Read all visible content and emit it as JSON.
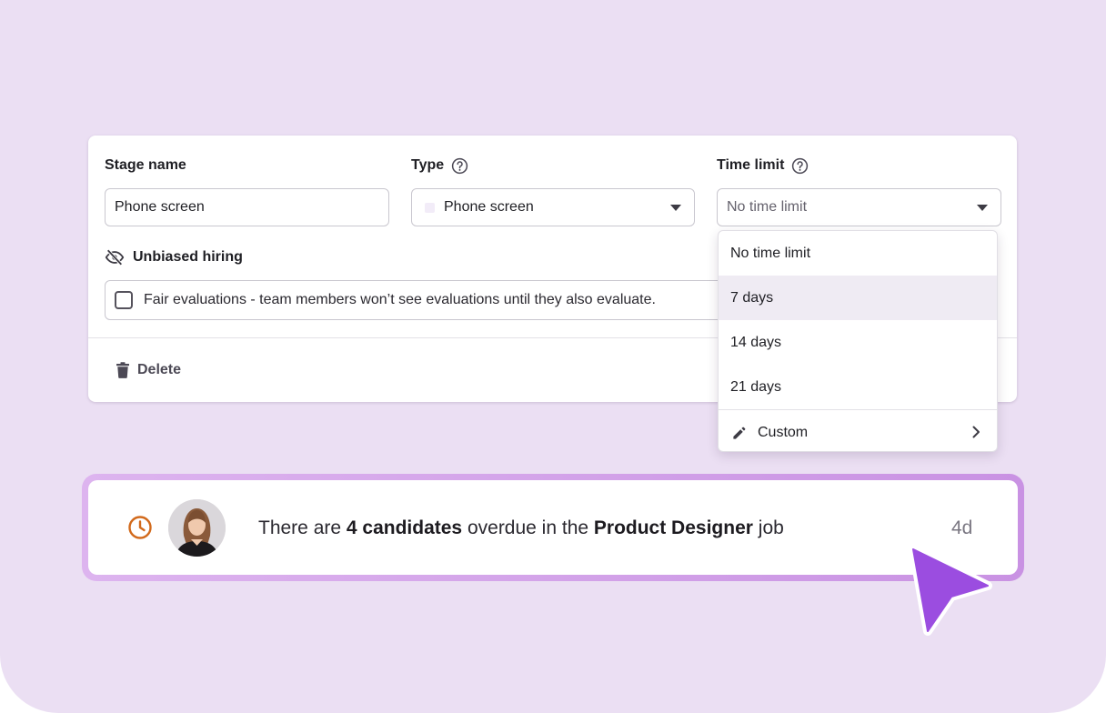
{
  "stage_form": {
    "stage_name": {
      "label": "Stage name",
      "value": "Phone screen"
    },
    "type": {
      "label": "Type",
      "value": "Phone screen",
      "swatch_color": "#f2ecf8"
    },
    "time_limit": {
      "label": "Time limit",
      "placeholder": "No time limit"
    },
    "unbiased": {
      "label": "Unbiased hiring",
      "checkbox_label": "Fair evaluations - team members won’t see evaluations until they also evaluate.",
      "checked": false
    },
    "delete_label": "Delete"
  },
  "time_limit_menu": {
    "options": [
      {
        "label": "No time limit",
        "selected": false
      },
      {
        "label": "7 days",
        "selected": true
      },
      {
        "label": "14 days",
        "selected": false
      },
      {
        "label": "21 days",
        "selected": false
      }
    ],
    "custom_label": "Custom"
  },
  "notification": {
    "prefix": "There are ",
    "count_text": "4 candidates",
    "middle": " overdue in the ",
    "job": "Product Designer",
    "suffix": " job",
    "age": "4d"
  },
  "colors": {
    "background": "#ebdff3",
    "accent_purple": "#9b4de0",
    "clock_orange": "#d26a1c"
  },
  "icons": [
    "help-icon",
    "eye-off-icon",
    "trash-icon",
    "pencil-icon",
    "chevron-right-icon",
    "clock-icon",
    "cursor-arrow-icon"
  ]
}
